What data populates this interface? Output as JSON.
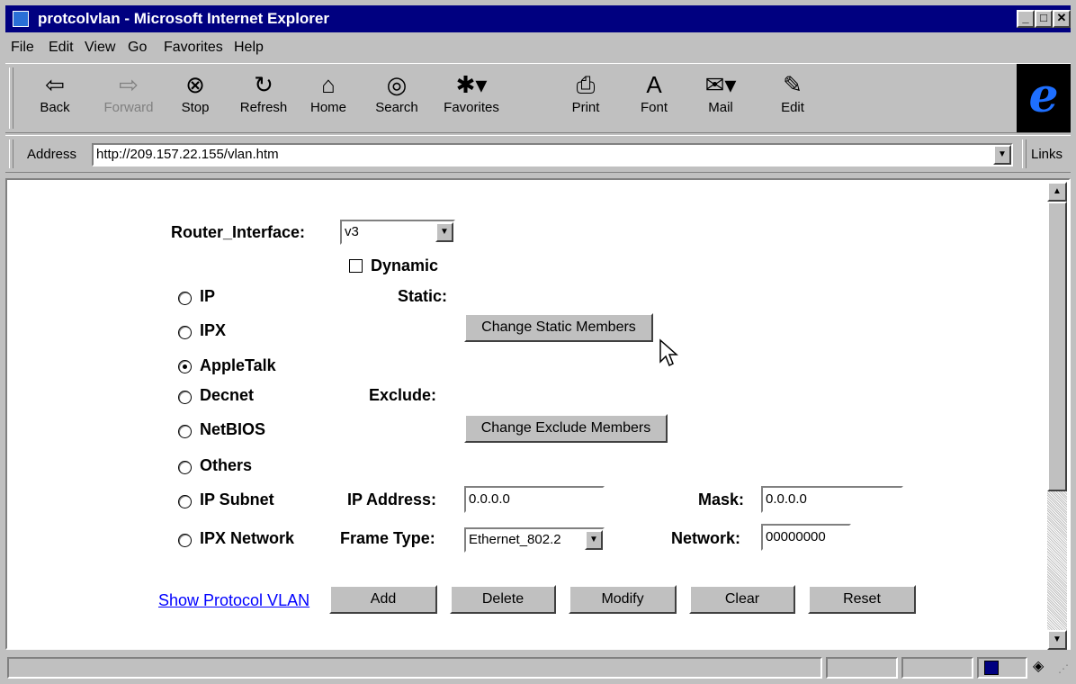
{
  "window": {
    "title": "protcolvlan - Microsoft Internet Explorer"
  },
  "menu": [
    "File",
    "Edit",
    "View",
    "Go",
    "Favorites",
    "Help"
  ],
  "toolbar": {
    "buttons": [
      {
        "label": "Back",
        "icon": "back-arrow-icon"
      },
      {
        "label": "Forward",
        "icon": "forward-arrow-icon",
        "disabled": true
      },
      {
        "label": "Stop",
        "icon": "stop-icon"
      },
      {
        "label": "Refresh",
        "icon": "refresh-icon"
      },
      {
        "label": "Home",
        "icon": "home-icon"
      },
      {
        "label": "Search",
        "icon": "search-icon"
      },
      {
        "label": "Favorites",
        "icon": "favorites-icon"
      },
      {
        "label": "Print",
        "icon": "print-icon"
      },
      {
        "label": "Font",
        "icon": "font-icon"
      },
      {
        "label": "Mail",
        "icon": "mail-icon"
      },
      {
        "label": "Edit",
        "icon": "edit-icon"
      }
    ]
  },
  "address": {
    "label": "Address",
    "url": "http://209.157.22.155/vlan.htm",
    "links_label": "Links"
  },
  "form": {
    "router_interface_label": "Router_Interface:",
    "router_interface_value": "v3",
    "dynamic_label": "Dynamic",
    "dynamic_checked": false,
    "protocols": [
      {
        "label": "IP",
        "selected": false
      },
      {
        "label": "IPX",
        "selected": false
      },
      {
        "label": "AppleTalk",
        "selected": true
      },
      {
        "label": "Decnet",
        "selected": false
      },
      {
        "label": "NetBIOS",
        "selected": false
      },
      {
        "label": "Others",
        "selected": false
      },
      {
        "label": "IP Subnet",
        "selected": false
      },
      {
        "label": "IPX Network",
        "selected": false
      }
    ],
    "static_label": "Static:",
    "change_static_label": "Change Static Members",
    "exclude_label": "Exclude:",
    "change_exclude_label": "Change Exclude Members",
    "ip_address_label": "IP Address:",
    "ip_address_value": "0.0.0.0",
    "mask_label": "Mask:",
    "mask_value": "0.0.0.0",
    "frame_type_label": "Frame Type:",
    "frame_type_value": "Ethernet_802.2",
    "network_label": "Network:",
    "network_value": "00000000",
    "show_link": "Show Protocol VLAN",
    "actions": [
      "Add",
      "Delete",
      "Modify",
      "Clear",
      "Reset"
    ]
  },
  "colors": {
    "titlebar": "#000080",
    "chrome": "#c0c0c0",
    "link": "#0000ff"
  }
}
